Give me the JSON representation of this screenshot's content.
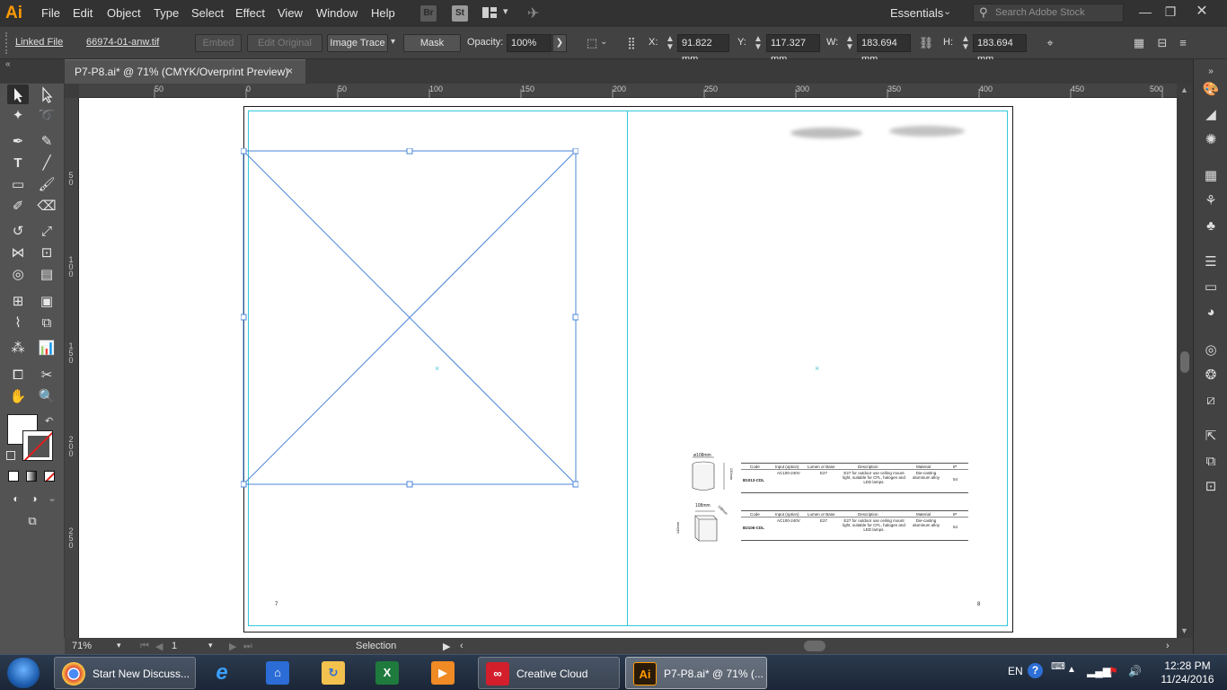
{
  "app": {
    "logo": "Ai",
    "menu": [
      "File",
      "Edit",
      "Object",
      "Type",
      "Select",
      "Effect",
      "View",
      "Window",
      "Help"
    ],
    "bridge_label": "Br",
    "stock_label": "St",
    "workspace": "Essentials",
    "stock_search_placeholder": "Search Adobe Stock"
  },
  "control_bar": {
    "linked_file_label": "Linked File",
    "file_name": "66974-01-anw.tif",
    "embed_label": "Embed",
    "edit_original_label": "Edit Original",
    "image_trace_label": "Image Trace",
    "mask_label": "Mask",
    "opacity_label": "Opacity:",
    "opacity_value": "100%",
    "x_label": "X:",
    "x_value": "91.822 mm",
    "y_label": "Y:",
    "y_value": "117.327 mm",
    "w_label": "W:",
    "w_value": "183.694 mm",
    "h_label": "H:",
    "h_value": "183.694 mm"
  },
  "document": {
    "tab_title": "P7-P8.ai* @ 71% (CMYK/Overprint Preview)",
    "close_glyph": "×"
  },
  "rulers": {
    "horizontal": [
      "50",
      "0",
      "50",
      "100",
      "150",
      "200",
      "250",
      "300",
      "350",
      "400",
      "450",
      "500"
    ],
    "vertical": [
      "50",
      "100",
      "150",
      "200",
      "250"
    ]
  },
  "artboard": {
    "left_page_number": "7",
    "right_page_number": "8",
    "products": [
      {
        "dimension_top": "ø108mm",
        "dimension_side": "130mm",
        "headers": [
          "Code",
          "Input (option)",
          "Lumen or Base",
          "Description",
          "Material",
          "IP"
        ],
        "code": "B1013-CDL",
        "input": "AC100-240V",
        "base": "E27",
        "description": "E27 for outdoor use ceiling mount light, suitable for CFL, halogen and LED lamps.",
        "material": "Die-casting aluminum alloy",
        "ip": "54"
      },
      {
        "dimension_top": "108mm",
        "dimension_side": "140mm",
        "dimension_depth": "108mm",
        "headers": [
          "Code",
          "Input (option)",
          "Lumen or Base",
          "Description",
          "Material",
          "IP"
        ],
        "code": "B2106-CDL",
        "input": "AC100-240V",
        "base": "E27",
        "description": "E27 for outdoor use ceiling mount light, suitable for CFL, halogen and LED lamps.",
        "material": "Die-casting aluminum alloy",
        "ip": "54"
      }
    ]
  },
  "status_bar": {
    "zoom": "71%",
    "artboard_index": "1",
    "current_tool": "Selection"
  },
  "taskbar": {
    "apps": [
      {
        "label": "Start New Discuss...",
        "icon": "chrome-icon"
      },
      {
        "label": "",
        "icon": "ie-icon"
      },
      {
        "label": "",
        "icon": "file-explorer-icon"
      },
      {
        "label": "",
        "icon": "folder-icon"
      },
      {
        "label": "",
        "icon": "excel-icon"
      },
      {
        "label": "",
        "icon": "media-player-icon"
      },
      {
        "label": "Creative Cloud",
        "icon": "creative-cloud-icon"
      },
      {
        "label": "P7-P8.ai* @ 71% (...",
        "icon": "illustrator-icon"
      }
    ],
    "language": "EN",
    "time": "12:28 PM",
    "date": "11/24/2016"
  },
  "colors": {
    "accent": "#ff9a00",
    "selection": "#4a86d8",
    "guide": "#2cc7d6"
  }
}
